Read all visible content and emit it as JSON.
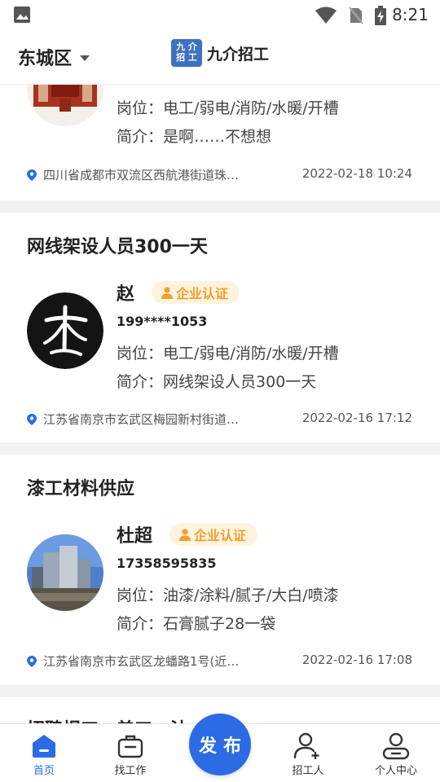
{
  "status_bar": {
    "time": "8:21",
    "icons": [
      "image-icon",
      "wifi-icon",
      "no-sim-icon",
      "battery-charging-icon"
    ]
  },
  "header": {
    "district": "东城区",
    "brand_logo_text": "九介招工",
    "brand_name": "九介招工"
  },
  "cards": [
    {
      "job": "电工/弱电/消防/水暖/开槽",
      "intro": "是啊……不想想",
      "location": "四川省成都市双流区西航港街道珠…",
      "date": "2022-02-18 10:24"
    },
    {
      "title": "网线架设人员300一天",
      "name": "赵",
      "badge": "企业认证",
      "phone": "199****1053",
      "job": "电工/弱电/消防/水暖/开槽",
      "intro": "网线架设人员300一天",
      "location": "江苏省南京市玄武区梅园新村街道…",
      "date": "2022-02-16 17:12"
    },
    {
      "title": "漆工材料供应",
      "name": "杜超",
      "badge": "企业认证",
      "phone": "17358595835",
      "job": "油漆/涂料/腻子/大白/喷漆",
      "intro": "石膏腻子28一袋",
      "location": "江苏省南京市玄武区龙蟠路1号(近…",
      "date": "2022-02-16 17:08"
    },
    {
      "title": "招聘焊工、普工、油"
    }
  ],
  "labels": {
    "job_prefix": "岗位：",
    "intro_prefix": "简介："
  },
  "tabbar": {
    "home": "首页",
    "find_job": "找工作",
    "publish": "发布",
    "hire": "招工人",
    "profile": "个人中心"
  },
  "colors": {
    "accent": "#2b6be4",
    "badge_bg": "#fff3df",
    "badge_text": "#f0a02a"
  }
}
